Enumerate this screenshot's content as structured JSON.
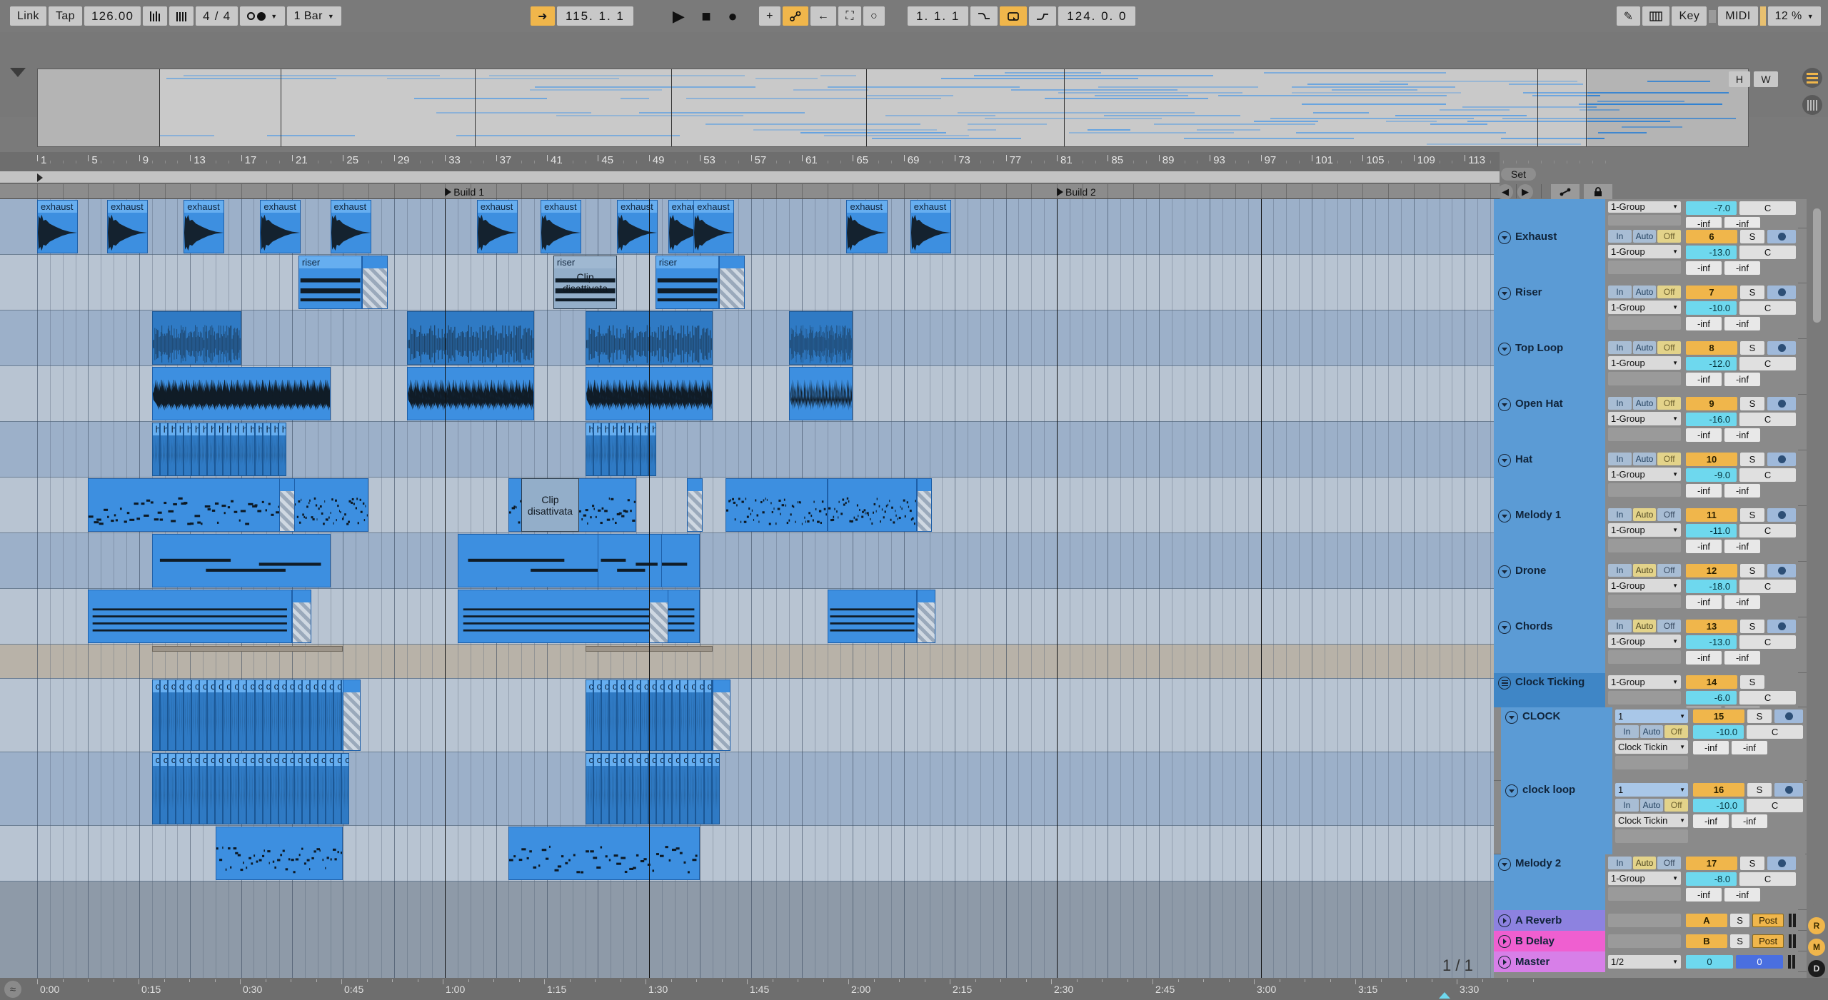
{
  "transport": {
    "link_label": "Link",
    "tap_label": "Tap",
    "tempo": "126.00",
    "metronome_icon": "metronome-icon",
    "time_signature": "4 / 4",
    "quantize_label": "1 Bar",
    "follow_icon": "follow-icon",
    "arrangement_position": "115.  1.  1",
    "play_icon": "play-icon",
    "stop_icon": "stop-icon",
    "record_icon": "record-icon",
    "draw_plus_icon": "plus-icon",
    "automation_icon": "automation-icon",
    "back_icon": "back-arrow-icon",
    "fit_icon": "fit-icon",
    "circle_icon": "circle-icon",
    "loop_start": "1.  1.  1",
    "punch_in_icon": "punch-in-icon",
    "loop_toggle_icon": "loop-icon",
    "punch_out_icon": "punch-out-icon",
    "loop_length": "124.  0.  0",
    "pencil_icon": "pencil-icon",
    "keyboard_icon": "keyboard-icon",
    "key_label": "Key",
    "midi_label": "MIDI",
    "cpu_load": "12 %"
  },
  "overview": {
    "h_button": "H",
    "w_button": "W",
    "menu_icon": "hamburger-menu-icon",
    "columns_icon": "columns-icon"
  },
  "ruler": {
    "bars": [
      1,
      5,
      9,
      13,
      17,
      21,
      25,
      29,
      33,
      37,
      41,
      45,
      49,
      53,
      57,
      61,
      65,
      69,
      73,
      77,
      81,
      85,
      89,
      93,
      97,
      101,
      105,
      109,
      113
    ]
  },
  "locators": [
    {
      "label": "Build 1",
      "bar": 33
    },
    {
      "label": "Build 2",
      "bar": 81
    }
  ],
  "setbar": {
    "set_label": "Set",
    "back_icon": "arrow-left-icon",
    "forward_icon": "arrow-right-icon",
    "automation_pencil_icon": "automation-pencil-icon",
    "lock_icon": "lock-icon"
  },
  "clip_text": {
    "exhaust": "exhaust",
    "riser": "riser",
    "hat": "ha",
    "clock": "cl",
    "deactivated": "Clip disattivata"
  },
  "tracks": [
    {
      "name": "Exhaust",
      "kind": "audio",
      "num": "6",
      "vol": "-13.0",
      "pan": "C",
      "sendA": "-inf",
      "sendB": "-inf",
      "routing": "1-Group",
      "io": "off",
      "solo": "S",
      "arm": true,
      "color": "#5b9bd5"
    },
    {
      "name": "Riser",
      "kind": "audio",
      "num": "7",
      "vol": "-10.0",
      "pan": "C",
      "sendA": "-inf",
      "sendB": "-inf",
      "routing": "1-Group",
      "io": "off",
      "solo": "S",
      "arm": true,
      "color": "#5b9bd5"
    },
    {
      "name": "Top Loop",
      "kind": "audio",
      "num": "8",
      "vol": "-12.0",
      "pan": "C",
      "sendA": "-inf",
      "sendB": "-inf",
      "routing": "1-Group",
      "io": "off",
      "solo": "S",
      "arm": true,
      "color": "#5b9bd5"
    },
    {
      "name": "Open Hat",
      "kind": "audio",
      "num": "9",
      "vol": "-16.0",
      "pan": "C",
      "sendA": "-inf",
      "sendB": "-inf",
      "routing": "1-Group",
      "io": "off",
      "solo": "S",
      "arm": true,
      "color": "#5b9bd5"
    },
    {
      "name": "Hat",
      "kind": "audio",
      "num": "10",
      "vol": "-9.0",
      "pan": "C",
      "sendA": "-inf",
      "sendB": "-inf",
      "routing": "1-Group",
      "io": "off",
      "solo": "S",
      "arm": true,
      "color": "#5b9bd5"
    },
    {
      "name": "Melody 1",
      "kind": "audio",
      "num": "11",
      "vol": "-11.0",
      "pan": "C",
      "sendA": "-inf",
      "sendB": "-inf",
      "routing": "1-Group",
      "io": "auto",
      "solo": "S",
      "arm": true,
      "color": "#5b9bd5"
    },
    {
      "name": "Drone",
      "kind": "audio",
      "num": "12",
      "vol": "-18.0",
      "pan": "C",
      "sendA": "-inf",
      "sendB": "-inf",
      "routing": "1-Group",
      "io": "auto",
      "solo": "S",
      "arm": true,
      "color": "#5b9bd5"
    },
    {
      "name": "Chords",
      "kind": "audio",
      "num": "13",
      "vol": "-13.0",
      "pan": "C",
      "sendA": "-inf",
      "sendB": "-inf",
      "routing": "1-Group",
      "io": "auto",
      "solo": "S",
      "arm": true,
      "color": "#5b9bd5"
    },
    {
      "name": "Clock Ticking",
      "kind": "group",
      "num": "14",
      "vol": "-6.0",
      "pan": "C",
      "sendA": "-inf",
      "sendB": "-inf",
      "routing": "1-Group",
      "io": "none",
      "solo": "S",
      "arm": false,
      "color": "#3f86c6"
    },
    {
      "name": "CLOCK",
      "kind": "midi",
      "num": "15",
      "vol": "-10.0",
      "pan": "C",
      "sendA": "-inf",
      "sendB": "-inf",
      "routing": "Clock Tickin",
      "midi_in": "1",
      "io": "off",
      "solo": "S",
      "arm": true,
      "color": "#5b9bd5"
    },
    {
      "name": "clock loop",
      "kind": "midi",
      "num": "16",
      "vol": "-10.0",
      "pan": "C",
      "sendA": "-inf",
      "sendB": "-inf",
      "routing": "Clock Tickin",
      "midi_in": "1",
      "io": "off",
      "solo": "S",
      "arm": true,
      "color": "#5b9bd5"
    },
    {
      "name": "Melody 2",
      "kind": "audio",
      "num": "17",
      "vol": "-8.0",
      "pan": "C",
      "sendA": "-inf",
      "sendB": "-inf",
      "routing": "1-Group",
      "io": "auto",
      "solo": "S",
      "arm": true,
      "color": "#5b9bd5"
    }
  ],
  "partial_top_track": {
    "vol": "-7.0",
    "pan": "C",
    "sendA": "-inf",
    "sendB": "-inf",
    "routing": "1-Group"
  },
  "returns": [
    {
      "name": "A Reverb",
      "letter": "A",
      "solo": "S",
      "mode": "Post",
      "color": "#8d82e0"
    },
    {
      "name": "B Delay",
      "letter": "B",
      "solo": "S",
      "mode": "Post",
      "color": "#ef5fd0"
    }
  ],
  "master": {
    "name": "Master",
    "crossfade": "1/2",
    "volume": "0",
    "meter_value": "0",
    "color": "#d77fe8"
  },
  "rail_icons": [
    {
      "name": "record-rail-icon",
      "label": "R"
    },
    {
      "name": "midi-rail-icon",
      "label": "M"
    },
    {
      "name": "device-rail-icon",
      "label": "D"
    }
  ],
  "timeline": {
    "marks": [
      "0:00",
      "0:15",
      "0:30",
      "0:45",
      "1:00",
      "1:15",
      "1:30",
      "1:45",
      "2:00",
      "2:15",
      "2:30",
      "2:45",
      "3:00",
      "3:15",
      "3:30"
    ],
    "wave_icon": "waveform-icon"
  },
  "scene_counter": "1 / 1"
}
